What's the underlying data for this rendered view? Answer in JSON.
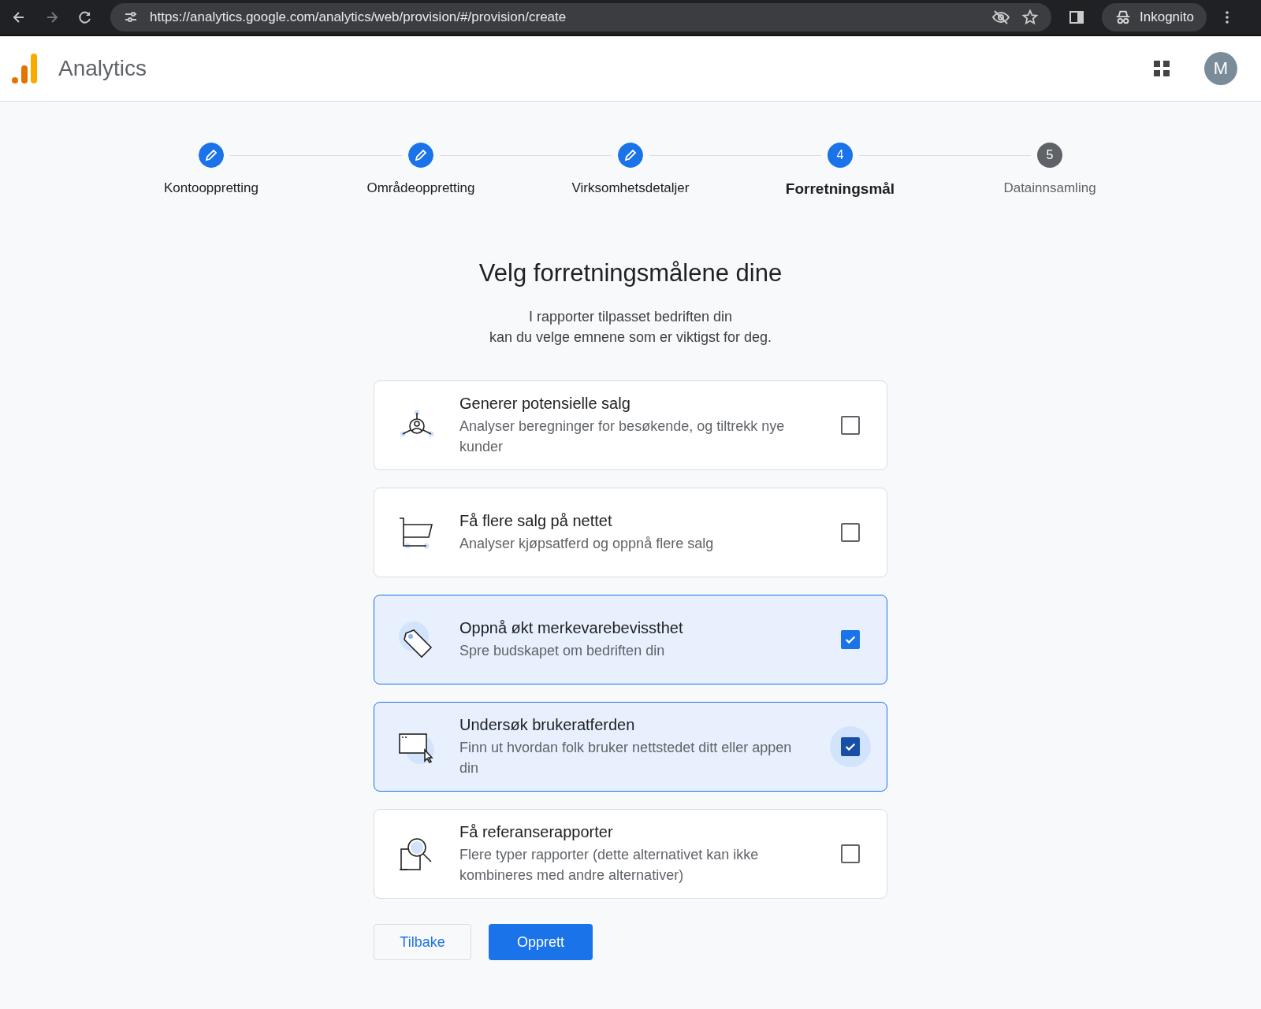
{
  "browser": {
    "url": "https://analytics.google.com/analytics/web/provision/#/provision/create",
    "profile": "Inkognito"
  },
  "header": {
    "product": "Analytics",
    "avatar": "M"
  },
  "steps": [
    {
      "label": "Kontooppretting",
      "completed": true,
      "selected": false
    },
    {
      "label": "Områdeoppretting",
      "completed": true,
      "selected": false
    },
    {
      "label": "Virksomhetsdetaljer",
      "completed": true,
      "selected": false
    },
    {
      "label": "Forretningsmål",
      "completed": false,
      "selected": true,
      "number": "4"
    },
    {
      "label": "Datainnsamling",
      "completed": false,
      "selected": false,
      "number": "5"
    }
  ],
  "heading": "Velg forretningsmålene dine",
  "intro": [
    "I rapporter tilpasset bedriften din",
    "kan du velge emnene som er viktigst for deg."
  ],
  "options": [
    {
      "kind": "leads",
      "title": "Generer potensielle salg",
      "description": "Analyser beregninger for besøkende, og tiltrekk nye kunder",
      "checked": false,
      "focused": false
    },
    {
      "kind": "cart",
      "title": "Få flere salg på nettet",
      "description": "Analyser kjøpsatferd og oppnå flere salg",
      "checked": false,
      "focused": false
    },
    {
      "kind": "tag",
      "title": "Oppnå økt merkevarebevissthet",
      "description": "Spre budskapet om bedriften din",
      "checked": true,
      "focused": false
    },
    {
      "kind": "window",
      "title": "Undersøk brukeratferden",
      "description": "Finn ut hvordan folk bruker nettstedet ditt eller appen din",
      "checked": true,
      "focused": true
    },
    {
      "kind": "search",
      "title": "Få referanserapporter",
      "description": "Flere typer rapporter (dette alternativet kan ikke kombineres med andre alternativer)",
      "checked": false,
      "focused": false
    }
  ],
  "buttons": {
    "back": "Tilbake",
    "create": "Opprett"
  }
}
